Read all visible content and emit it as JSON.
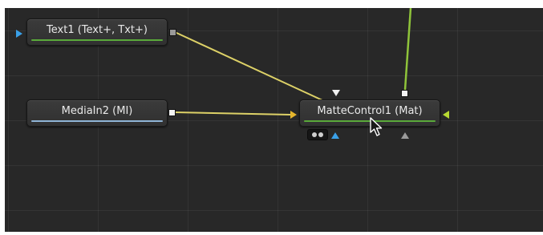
{
  "nodes": {
    "text1": {
      "title": "Text1  (Text+, Txt+)",
      "color": "#5aa93a"
    },
    "mediain2": {
      "title": "MediaIn2  (MI)",
      "color": "#8fb4d6"
    },
    "mattecontrol1": {
      "title": "MatteControl1  (Mat)",
      "color": "#5aa93a"
    }
  },
  "colors": {
    "background": "#282828",
    "link_yellow": "#ddd167",
    "link_green": "#8fc43a",
    "input_blue": "#3aa0e8",
    "input_lime": "#b7d932"
  },
  "icons": {
    "pointer": "mouse-pointer-icon",
    "view_toggle": "view-toggle-icon"
  }
}
